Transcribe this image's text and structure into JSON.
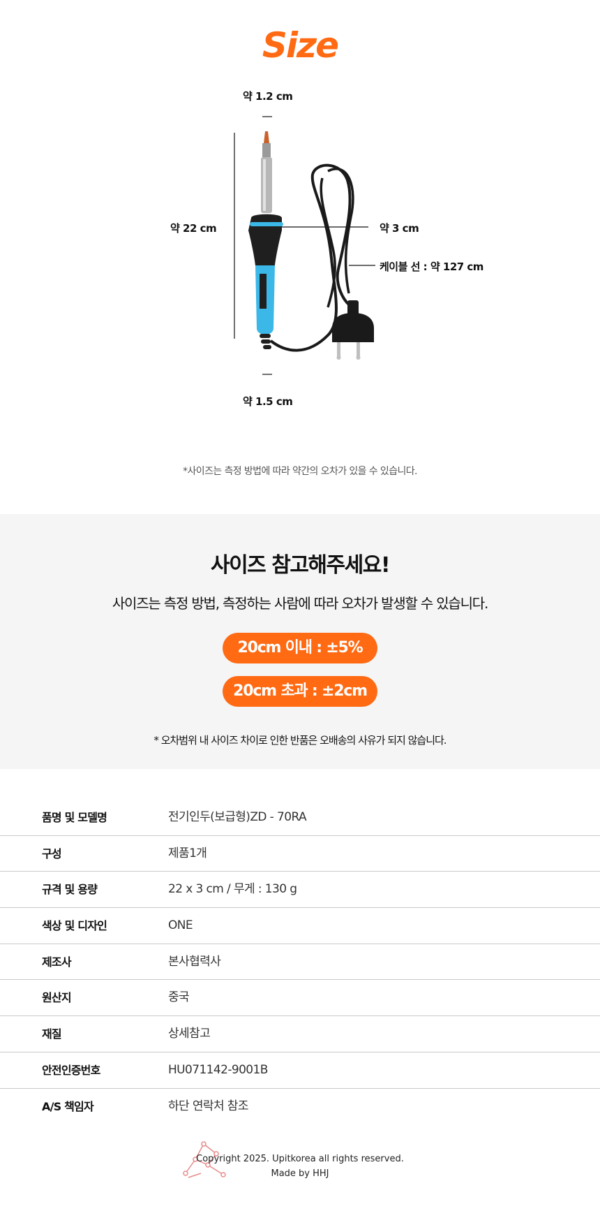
{
  "header": {
    "title": "Size"
  },
  "dimensions": {
    "tip_width": "약 1.2 cm",
    "length": "약 22 cm",
    "grip_width": "약 3 cm",
    "cable": "케이블 선 : 약 127 cm",
    "base_width": "약 1.5 cm"
  },
  "size_note": "*사이즈는 측정 방법에 따라 약간의 오차가 있을 수 있습니다.",
  "reference": {
    "title": "사이즈 참고해주세요!",
    "description": "사이즈는 측정 방법, 측정하는 사람에 따라 오차가 발생할 수 있습니다.",
    "tolerance_under": "20cm 이내 : ±5%",
    "tolerance_over": "20cm 초과 : ±2cm",
    "note": "* 오차범위 내 사이즈 차이로 인한 반품은 오배송의 사유가 되지 않습니다."
  },
  "specs": [
    {
      "label": "품명 및 모델명",
      "value": "전기인두(보급형)ZD - 70RA"
    },
    {
      "label": "구성",
      "value": "제품1개"
    },
    {
      "label": "규격 및 용량",
      "value": "22 x 3 cm / 무게 : 130 g"
    },
    {
      "label": "색상 및 디자인",
      "value": "ONE"
    },
    {
      "label": "제조사",
      "value": "본사협력사"
    },
    {
      "label": "원산지",
      "value": "중국"
    },
    {
      "label": "재질",
      "value": "상세참고"
    },
    {
      "label": "안전인증번호",
      "value": "HU071142-9001B"
    },
    {
      "label": "A/S 책임자",
      "value": "하단 연락처 참조"
    }
  ],
  "footer": {
    "copyright": "Copyright 2025. Upitkorea all rights reserved.",
    "made_by": "Made by HHJ"
  },
  "colors": {
    "accent": "#ff6a13",
    "product_blue": "#3cb8e8",
    "section_bg": "#f5f5f5"
  },
  "icons": {
    "footer_logo": "constellation-logo-icon"
  }
}
